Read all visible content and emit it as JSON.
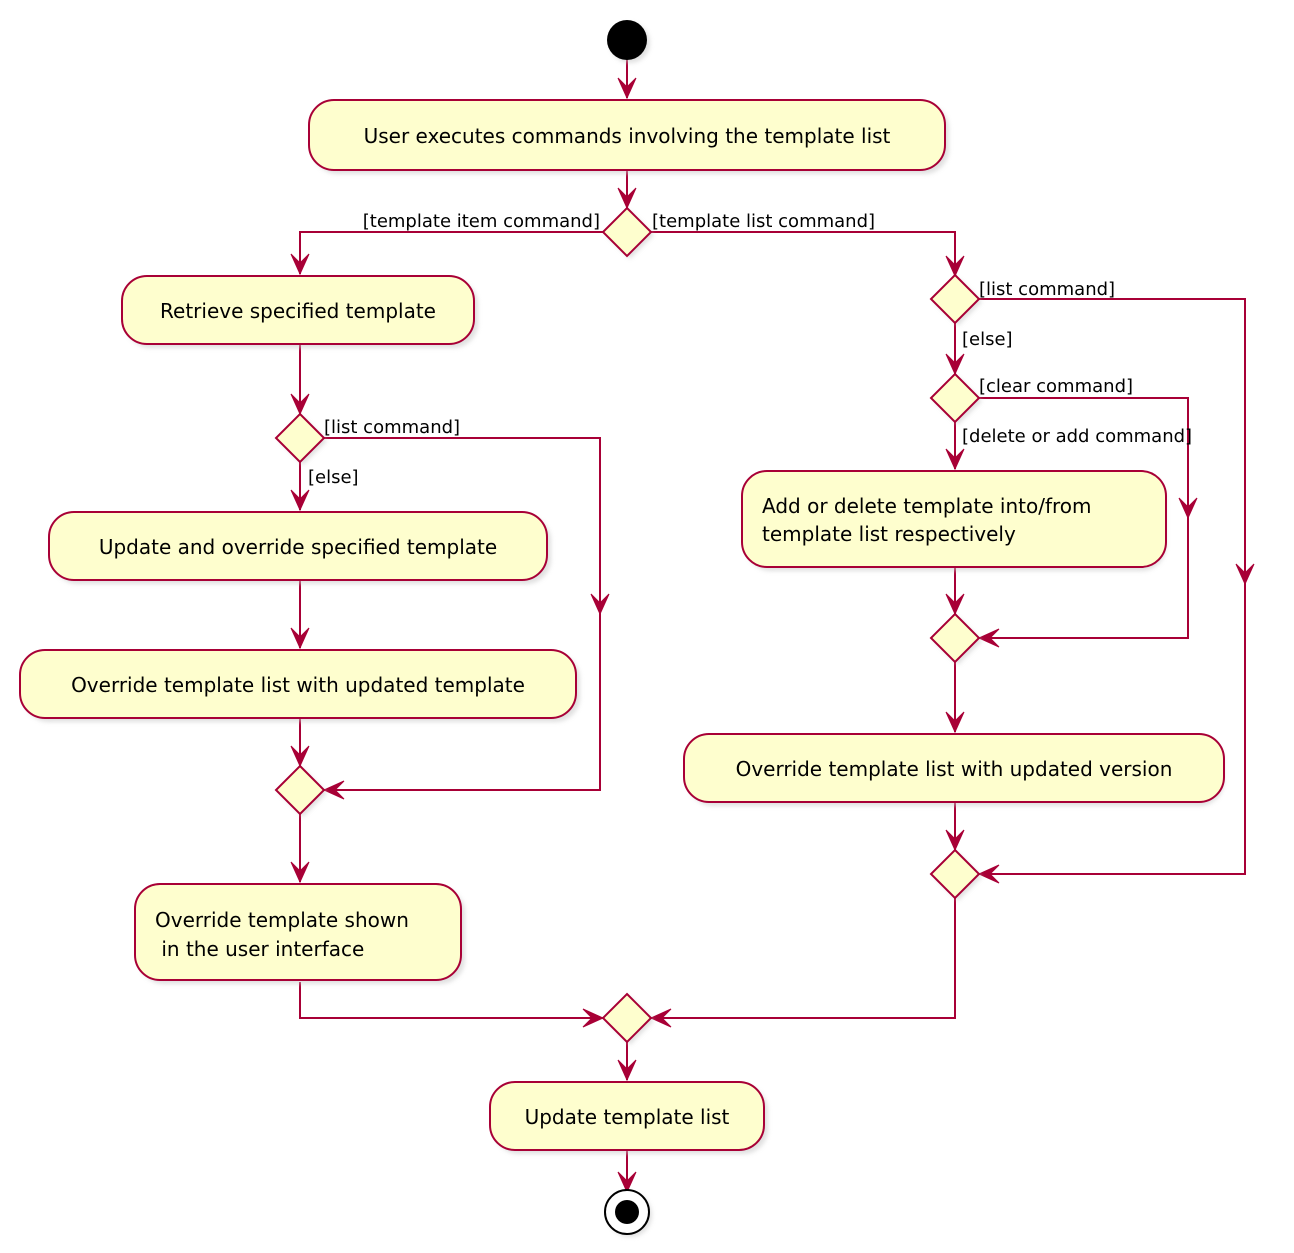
{
  "diagram": {
    "type": "activity",
    "colors": {
      "line": "#A80036",
      "fill": "#FEFECE",
      "text": "#000000",
      "start": "#000000"
    },
    "activities": {
      "user_executes": "User executes commands involving the template list",
      "retrieve": "Retrieve specified template",
      "update_override": "Update and override specified template",
      "override_list_template": "Override template list with updated template",
      "override_shown": [
        "Override template shown",
        " in the user interface"
      ],
      "add_delete": [
        "Add or delete template into/from",
        "template list respectively"
      ],
      "override_list_version": "Override template list with updated version",
      "update_list": "Update template list"
    },
    "guards": {
      "item_command": "[template item command]",
      "list_command_top": "[template list command]",
      "left_list": "[list command]",
      "left_else": "[else]",
      "right_list": "[list command]",
      "right_else": "[else]",
      "clear": "[clear command]",
      "delete_add": "[delete or add command]"
    }
  }
}
